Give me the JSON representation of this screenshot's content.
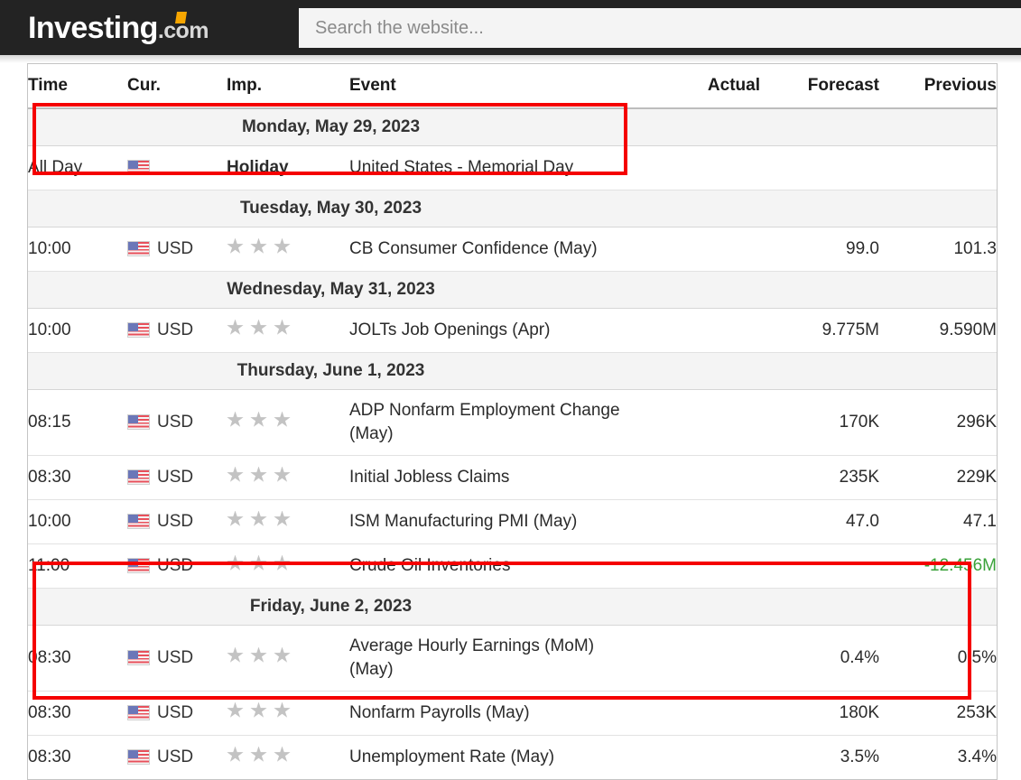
{
  "header": {
    "logo_main": "Investing",
    "logo_dot": ".",
    "logo_com": "com",
    "search_placeholder": "Search the website..."
  },
  "table": {
    "columns": [
      "Time",
      "Cur.",
      "Imp.",
      "Event",
      "Actual",
      "Forecast",
      "Previous"
    ],
    "rows": [
      {
        "kind": "day",
        "label": "Monday, May 29, 2023"
      },
      {
        "kind": "event",
        "time": "All Day",
        "currency": "",
        "flag": "us-flag-icon",
        "importance_text": "Holiday",
        "stars": 0,
        "event": "United States - Memorial Day",
        "actual": "",
        "forecast": "",
        "previous": "",
        "previous_color": ""
      },
      {
        "kind": "day",
        "label": "Tuesday, May 30, 2023"
      },
      {
        "kind": "event",
        "time": "10:00",
        "currency": "USD",
        "flag": "us-flag-icon",
        "importance_text": "",
        "stars": 3,
        "event": "CB Consumer Confidence (May)",
        "actual": "",
        "forecast": "99.0",
        "previous": "101.3",
        "previous_color": ""
      },
      {
        "kind": "day",
        "label": "Wednesday, May 31, 2023"
      },
      {
        "kind": "event",
        "time": "10:00",
        "currency": "USD",
        "flag": "us-flag-icon",
        "importance_text": "",
        "stars": 3,
        "event": "JOLTs Job Openings (Apr)",
        "actual": "",
        "forecast": "9.775M",
        "previous": "9.590M",
        "previous_color": ""
      },
      {
        "kind": "day",
        "label": "Thursday, June 1, 2023"
      },
      {
        "kind": "event",
        "time": "08:15",
        "currency": "USD",
        "flag": "us-flag-icon",
        "importance_text": "",
        "stars": 3,
        "tall": true,
        "event": "ADP Nonfarm Employment Change (May)",
        "actual": "",
        "forecast": "170K",
        "previous": "296K",
        "previous_color": ""
      },
      {
        "kind": "event",
        "time": "08:30",
        "currency": "USD",
        "flag": "us-flag-icon",
        "importance_text": "",
        "stars": 3,
        "event": "Initial Jobless Claims",
        "actual": "",
        "forecast": "235K",
        "previous": "229K",
        "previous_color": ""
      },
      {
        "kind": "event",
        "time": "10:00",
        "currency": "USD",
        "flag": "us-flag-icon",
        "importance_text": "",
        "stars": 3,
        "event": "ISM Manufacturing PMI (May)",
        "actual": "",
        "forecast": "47.0",
        "previous": "47.1",
        "previous_color": ""
      },
      {
        "kind": "event",
        "time": "11:00",
        "currency": "USD",
        "flag": "us-flag-icon",
        "importance_text": "",
        "stars": 3,
        "event": "Crude Oil Inventories",
        "actual": "",
        "forecast": "",
        "previous": "-12.456M",
        "previous_color": "#3aa23a"
      },
      {
        "kind": "day",
        "label": "Friday, June 2, 2023"
      },
      {
        "kind": "event",
        "time": "08:30",
        "currency": "USD",
        "flag": "us-flag-icon",
        "importance_text": "",
        "stars": 3,
        "tall": true,
        "event": "Average Hourly Earnings (MoM) (May)",
        "actual": "",
        "forecast": "0.4%",
        "previous": "0.5%",
        "previous_color": ""
      },
      {
        "kind": "event",
        "time": "08:30",
        "currency": "USD",
        "flag": "us-flag-icon",
        "importance_text": "",
        "stars": 3,
        "event": "Nonfarm Payrolls (May)",
        "actual": "",
        "forecast": "180K",
        "previous": "253K",
        "previous_color": ""
      },
      {
        "kind": "event",
        "time": "08:30",
        "currency": "USD",
        "flag": "us-flag-icon",
        "importance_text": "",
        "stars": 3,
        "event": "Unemployment Rate (May)",
        "actual": "",
        "forecast": "3.5%",
        "previous": "3.4%",
        "previous_color": ""
      }
    ]
  },
  "annotations": [
    {
      "name": "highlight-memorial-day",
      "color": "#f50000"
    },
    {
      "name": "highlight-nfp-block",
      "color": "#f50000"
    }
  ]
}
